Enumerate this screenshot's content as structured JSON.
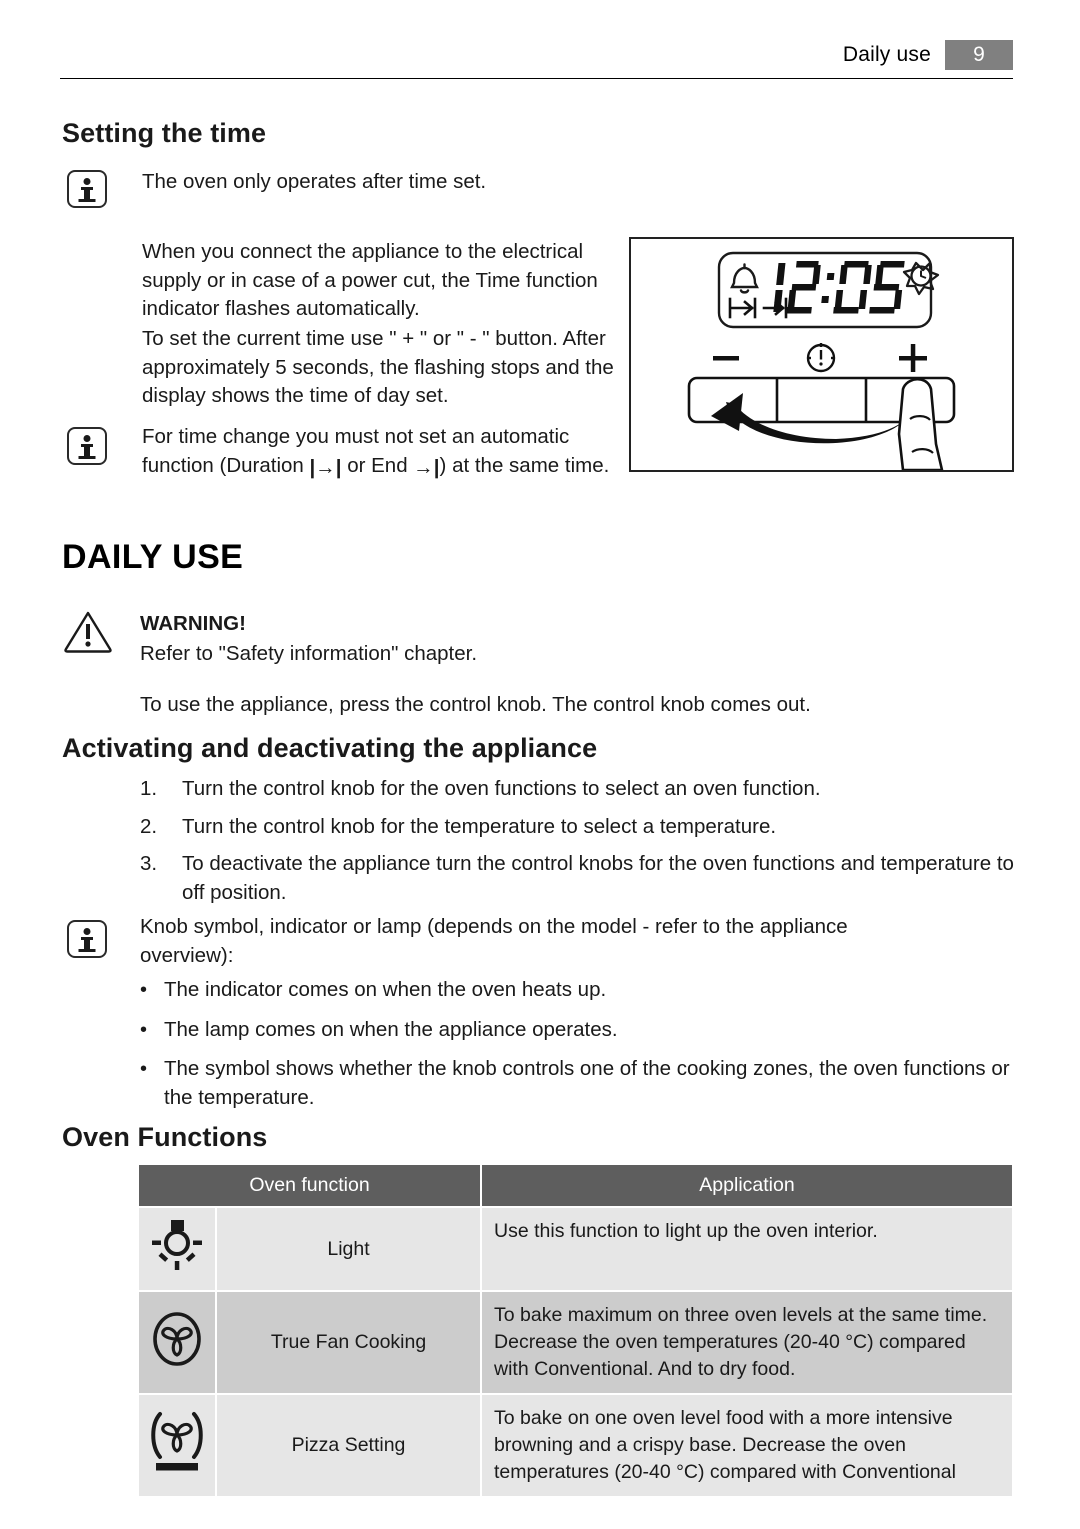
{
  "header": {
    "title": "Daily use",
    "page_number": "9"
  },
  "sections": {
    "setting_time": {
      "heading": "Setting the time",
      "note_1": "The oven only operates after time set.",
      "paragraph_1": "When you connect the appliance to the electrical supply or in case of a power cut, the Time function indicator flashes automatically.",
      "paragraph_2": "To set the current time use \" + \" or \" - \" button. After approximately 5 seconds, the flashing stops and the display shows the time of day set.",
      "note_2_part1": "For time change you must not set an automatic function (Duration ",
      "note_2_sym1": "|→|",
      "note_2_part2": " or End ",
      "note_2_sym2": "→|",
      "note_2_part3": ") at the same time."
    },
    "daily_use": {
      "heading": "DAILY USE",
      "warning_title": "WARNING!",
      "warning_text": "Refer to \"Safety information\" chapter.",
      "intro": "To use the appliance, press the control knob. The control knob comes out."
    },
    "activating": {
      "heading": "Activating and deactivating the appliance",
      "steps": [
        {
          "index": "1.",
          "text": "Turn the control knob for the oven functions to select an oven function."
        },
        {
          "index": "2.",
          "text": "Turn the control knob for the temperature to select a temperature."
        },
        {
          "index": "3.",
          "text": "To deactivate the appliance turn the control knobs for the oven functions and temperature to off position."
        }
      ],
      "knob_note": "Knob symbol, indicator or lamp (depends on the model - refer to the appliance overview):",
      "bullets": [
        "The indicator comes on when the oven heats up.",
        "The lamp comes on when the appliance operates.",
        "The symbol shows whether the knob controls one of the cooking zones, the oven functions or the temperature."
      ],
      "bullet_char": "•"
    },
    "oven_functions": {
      "heading": "Oven Functions",
      "columns": [
        "Oven function",
        "Application"
      ],
      "rows": [
        {
          "icon": "oven-light-icon",
          "name": "Light",
          "application": "Use this function to light up the oven interior."
        },
        {
          "icon": "true-fan-cooking-icon",
          "name": "True Fan Cooking",
          "application": "To bake maximum on three oven levels at the same time. Decrease the oven temperatures (20-40 °C) compared with Conventional. And to dry food."
        },
        {
          "icon": "pizza-setting-icon",
          "name": "Pizza Setting",
          "application": "To bake on one oven level food with a more intensive browning and a crispy base. Decrease the oven temperatures (20-40 °C) compared with Conventional"
        }
      ]
    }
  },
  "illustration": {
    "display_time": "12:05",
    "bell_indicator": "alarm-bell",
    "sun_clock_indicator": "minute-minder-clock",
    "duration_indicator": "|→|",
    "end_indicator": "→|",
    "button_minus": "−",
    "button_clock": "clock",
    "button_plus": "+"
  },
  "colors": {
    "header_badge": "#808080",
    "table_header": "#5e5e5e",
    "row_light": "#e6e6e6",
    "row_dark": "#cccccc",
    "ink": "#1a1a1a"
  }
}
